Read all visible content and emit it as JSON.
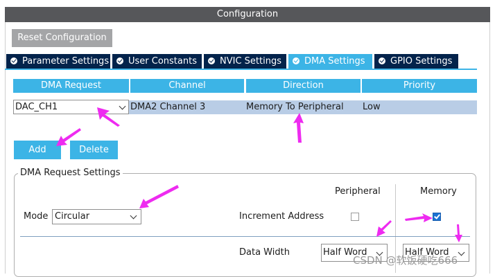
{
  "header": {
    "title": "Configuration"
  },
  "toolbar": {
    "reset_label": "Reset Configuration"
  },
  "tabs": [
    {
      "label": "Parameter Settings",
      "active": false,
      "icon": "check-circle-icon"
    },
    {
      "label": "User Constants",
      "active": false,
      "icon": "check-circle-icon"
    },
    {
      "label": "NVIC Settings",
      "active": false,
      "icon": "check-circle-icon"
    },
    {
      "label": "DMA Settings",
      "active": true,
      "icon": "check-circle-icon"
    },
    {
      "label": "GPIO Settings",
      "active": false,
      "icon": "check-circle-icon"
    }
  ],
  "table": {
    "headers": [
      "DMA Request",
      "Channel",
      "Direction",
      "Priority"
    ],
    "rows": [
      {
        "request": "DAC_CH1",
        "channel": "DMA2 Channel 3",
        "direction": "Memory To Peripheral",
        "priority": "Low"
      }
    ]
  },
  "actions": {
    "add_label": "Add",
    "delete_label": "Delete"
  },
  "settings": {
    "group_title": "DMA Request Settings",
    "mode_label": "Mode",
    "mode_value": "Circular",
    "peripheral_header": "Peripheral",
    "memory_header": "Memory",
    "increment_label": "Increment Address",
    "peripheral_increment": false,
    "memory_increment": true,
    "data_width_label": "Data Width",
    "peripheral_width": "Half Word",
    "memory_width": "Half Word"
  },
  "watermark": "CSDN @软饭硬吃666",
  "colors": {
    "header_bg": "#56575a",
    "tab_bg": "#03234b",
    "accent": "#3cb4e6",
    "selected_row": "#b9cde6",
    "annotation_arrows": "#ee2bf0"
  }
}
